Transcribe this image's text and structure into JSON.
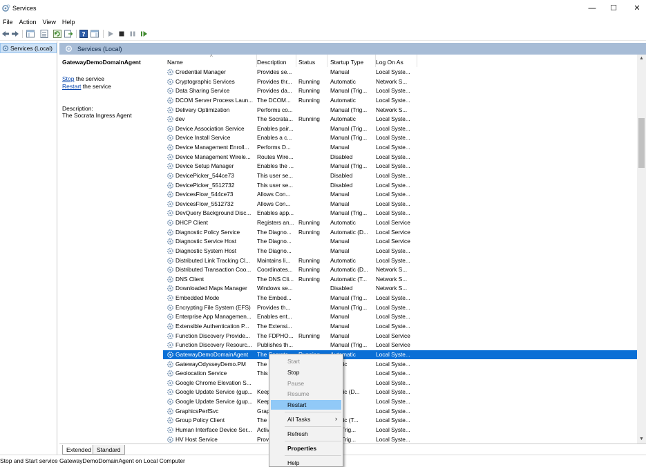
{
  "window": {
    "title": "Services"
  },
  "menu": [
    "File",
    "Action",
    "View",
    "Help"
  ],
  "tree": {
    "root": "Services (Local)"
  },
  "panel": {
    "header": "Services (Local)"
  },
  "details": {
    "service_name": "GatewayDemoDomainAgent",
    "stop_link": "Stop",
    "stop_suffix": " the service",
    "restart_link": "Restart",
    "restart_suffix": " the service",
    "description_label": "Description:",
    "description_text": "The Socrata Ingress Agent"
  },
  "columns": [
    "Name",
    "Description",
    "Status",
    "Startup Type",
    "Log On As"
  ],
  "services": [
    [
      "Credential Manager",
      "Provides se...",
      "",
      "Manual",
      "Local Syste..."
    ],
    [
      "Cryptographic Services",
      "Provides thr...",
      "Running",
      "Automatic",
      "Network S..."
    ],
    [
      "Data Sharing Service",
      "Provides da...",
      "Running",
      "Manual (Trig...",
      "Local Syste..."
    ],
    [
      "DCOM Server Process Laun...",
      "The DCOM...",
      "Running",
      "Automatic",
      "Local Syste..."
    ],
    [
      "Delivery Optimization",
      "Performs co...",
      "",
      "Manual (Trig...",
      "Network S..."
    ],
    [
      "dev",
      "The Socrata...",
      "Running",
      "Automatic",
      "Local Syste..."
    ],
    [
      "Device Association Service",
      "Enables pair...",
      "",
      "Manual (Trig...",
      "Local Syste..."
    ],
    [
      "Device Install Service",
      "Enables a c...",
      "",
      "Manual (Trig...",
      "Local Syste..."
    ],
    [
      "Device Management Enroll...",
      "Performs D...",
      "",
      "Manual",
      "Local Syste..."
    ],
    [
      "Device Management Wirele...",
      "Routes Wire...",
      "",
      "Disabled",
      "Local Syste..."
    ],
    [
      "Device Setup Manager",
      "Enables the ...",
      "",
      "Manual (Trig...",
      "Local Syste..."
    ],
    [
      "DevicePicker_544ce73",
      "This user se...",
      "",
      "Disabled",
      "Local Syste..."
    ],
    [
      "DevicePicker_5512732",
      "This user se...",
      "",
      "Disabled",
      "Local Syste..."
    ],
    [
      "DevicesFlow_544ce73",
      "Allows Con...",
      "",
      "Manual",
      "Local Syste..."
    ],
    [
      "DevicesFlow_5512732",
      "Allows Con...",
      "",
      "Manual",
      "Local Syste..."
    ],
    [
      "DevQuery Background Disc...",
      "Enables app...",
      "",
      "Manual (Trig...",
      "Local Syste..."
    ],
    [
      "DHCP Client",
      "Registers an...",
      "Running",
      "Automatic",
      "Local Service"
    ],
    [
      "Diagnostic Policy Service",
      "The Diagno...",
      "Running",
      "Automatic (D...",
      "Local Service"
    ],
    [
      "Diagnostic Service Host",
      "The Diagno...",
      "",
      "Manual",
      "Local Service"
    ],
    [
      "Diagnostic System Host",
      "The Diagno...",
      "",
      "Manual",
      "Local Syste..."
    ],
    [
      "Distributed Link Tracking Cl...",
      "Maintains li...",
      "Running",
      "Automatic",
      "Local Syste..."
    ],
    [
      "Distributed Transaction Coo...",
      "Coordinates...",
      "Running",
      "Automatic (D...",
      "Network S..."
    ],
    [
      "DNS Client",
      "The DNS Cli...",
      "Running",
      "Automatic (T...",
      "Network S..."
    ],
    [
      "Downloaded Maps Manager",
      "Windows se...",
      "",
      "Disabled",
      "Network S..."
    ],
    [
      "Embedded Mode",
      "The Embed...",
      "",
      "Manual (Trig...",
      "Local Syste..."
    ],
    [
      "Encrypting File System (EFS)",
      "Provides th...",
      "",
      "Manual (Trig...",
      "Local Syste..."
    ],
    [
      "Enterprise App Managemen...",
      "Enables ent...",
      "",
      "Manual",
      "Local Syste..."
    ],
    [
      "Extensible Authentication P...",
      "The Extensi...",
      "",
      "Manual",
      "Local Syste..."
    ],
    [
      "Function Discovery Provide...",
      "The FDPHO...",
      "Running",
      "Manual",
      "Local Service"
    ],
    [
      "Function Discovery Resourc...",
      "Publishes th...",
      "",
      "Manual (Trig...",
      "Local Service"
    ],
    [
      "GatewayDemoDomainAgent",
      "The Socrata...",
      "Running",
      "Automatic",
      "Local Syste..."
    ],
    [
      "GatewayOdysseyDemo.PM",
      "The S",
      "",
      "omatic",
      "Local Syste..."
    ],
    [
      "Geolocation Service",
      "This",
      "",
      "bled",
      "Local Syste..."
    ],
    [
      "Google Chrome Elevation S...",
      "",
      "",
      "ual",
      "Local Syste..."
    ],
    [
      "Google Update Service (gup...",
      "Keep",
      "",
      "omatic (D...",
      "Local Syste..."
    ],
    [
      "Google Update Service (gup...",
      "Keep",
      "",
      "ual",
      "Local Syste..."
    ],
    [
      "GraphicsPerfSvc",
      "Grap",
      "",
      "bled",
      "Local Syste..."
    ],
    [
      "Group Policy Client",
      "The s",
      "",
      "omatic (T...",
      "Local Syste..."
    ],
    [
      "Human Interface Device Ser...",
      "Activ",
      "",
      "ual (Trig...",
      "Local Syste..."
    ],
    [
      "HV Host Service",
      "Provi",
      "",
      "ual (Trig...",
      "Local Syste..."
    ]
  ],
  "selected_index": 30,
  "context_menu": {
    "start": "Start",
    "stop": "Stop",
    "pause": "Pause",
    "resume": "Resume",
    "restart": "Restart",
    "all_tasks": "All Tasks",
    "refresh": "Refresh",
    "properties": "Properties",
    "help": "Help"
  },
  "tabs": [
    "Extended",
    "Standard"
  ],
  "statusbar": {
    "text": "Stop and Start service GatewayDemoDomainAgent on Local Computer"
  },
  "icons": [
    "services-app-icon",
    "gear-icon",
    "back-icon",
    "forward-icon",
    "refresh-icon",
    "help-icon",
    "play-icon",
    "stop-icon",
    "pause-icon",
    "resume-icon"
  ],
  "colors": {
    "selection": "#0a6fd6",
    "panel_header": "#a7bcd6",
    "menu_highlight": "#91c9f7",
    "link": "#0645ad"
  }
}
